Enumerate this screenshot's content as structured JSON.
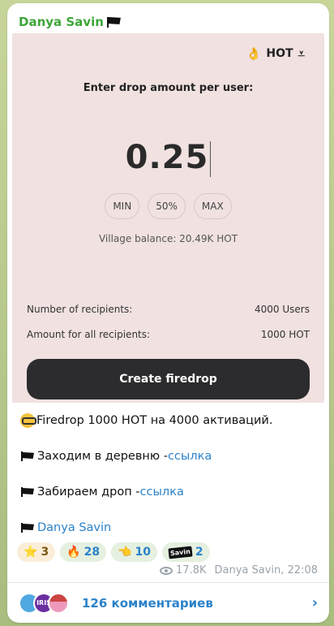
{
  "post": {
    "author": "Danya Savin",
    "views": "17.8K",
    "signature": "Danya Savin, 22:08"
  },
  "widget": {
    "token_label": "HOT",
    "prompt": "Enter drop amount per user:",
    "amount": "0.25",
    "quick": [
      "MIN",
      "50%",
      "MAX"
    ],
    "balance": "Village balance: 20.49K HOT",
    "recipients_label": "Number of recipients:",
    "recipients_value": "4000 Users",
    "total_label": "Amount for all recipients:",
    "total_value": "1000 HOT",
    "button_label": "Create firedrop"
  },
  "message": {
    "line1": "Firedrop 1000 HOT на 4000 активаций.",
    "line2_text": "Заходим в деревню - ",
    "line2_link": "ссылка",
    "line3_text": "Забираем дроп - ",
    "line3_link": "ссылка",
    "line4_link": "Danya Savin"
  },
  "reactions": [
    {
      "icon": "⭐",
      "count": "3"
    },
    {
      "icon": "🔥",
      "count": "28"
    },
    {
      "icon": "👈",
      "count": "10"
    },
    {
      "icon": "savin",
      "count": "2",
      "badge": "Savin"
    }
  ],
  "comments": {
    "label": "126 комментариев",
    "avatar2_text": "IRIS"
  },
  "colors": {
    "author": "#3fa63a",
    "link": "#2b82c9",
    "card_bg": "#f1e1e1",
    "button_bg": "#2c2c2e"
  }
}
